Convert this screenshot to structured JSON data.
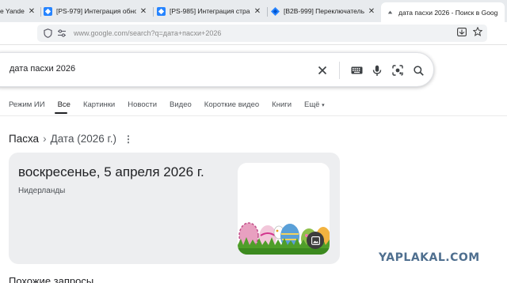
{
  "browser": {
    "tabs": [
      {
        "title": "e Yandex",
        "icon": "yandex-favicon",
        "active": false
      },
      {
        "title": "[PS-979] Интеграция обновлени",
        "icon": "jira-favicon",
        "active": false
      },
      {
        "title": "[PS-985] Интеграция страница с",
        "icon": "jira-favicon",
        "active": false
      },
      {
        "title": "[B2B-999] Переключатель обо",
        "icon": "jira-favicon",
        "active": false
      },
      {
        "title": "дата пасхи 2026 - Поиск в Goog",
        "icon": "google-favicon",
        "active": true
      }
    ],
    "url": "www.google.com/search?q=дата+пасхи+2026",
    "colors": {
      "tabbar_bg": "#e8ebee",
      "urlbar_bg": "#f0f2f4",
      "jira_blue": "#2684ff"
    }
  },
  "search": {
    "query": "дата пасхи 2026",
    "icons": [
      "clear-icon",
      "keyboard-icon",
      "mic-icon",
      "lens-icon",
      "search-icon"
    ]
  },
  "search_tabs": {
    "items": [
      "Режим ИИ",
      "Все",
      "Картинки",
      "Новости",
      "Видео",
      "Короткие видео",
      "Книги",
      "Ещё"
    ],
    "active": "Все"
  },
  "knowledge": {
    "breadcrumb": "Пасха",
    "subtitle": "Дата (2026 г.)",
    "date": "воскресенье, 5 апреля 2026 г.",
    "country": "Нидерланды",
    "image_icon": "image-icon"
  },
  "related_title": "Похожие запросы",
  "watermark": "YAPLAKAL.COM"
}
